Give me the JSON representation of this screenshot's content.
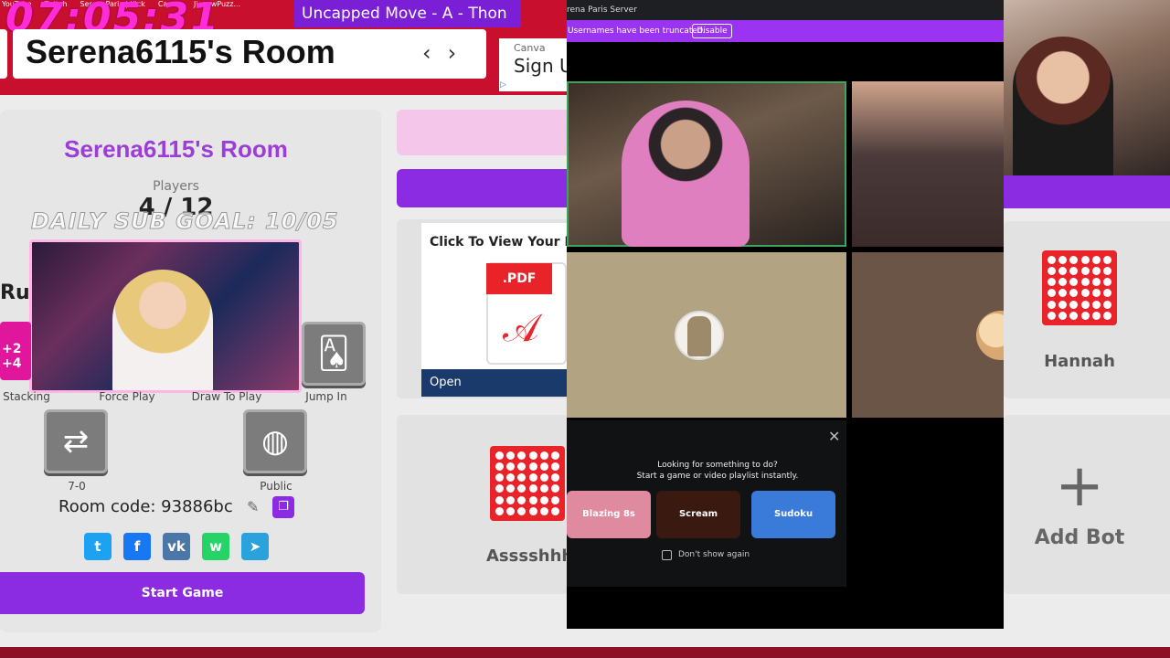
{
  "browser": {
    "bookmarks": [
      "YouTube",
      "Twitch",
      "SerenaParis | Kick",
      "Canva",
      "JigsawPuzz..."
    ],
    "timer": "07:05:31",
    "marquee": "Uncapped Move - A - Thon"
  },
  "header": {
    "room_title": "Serena6115's Room",
    "prev_arrow": "‹",
    "next_arrow": "›"
  },
  "ad_top": {
    "brand": "Canva",
    "cta": "Sign U",
    "mark": "▷"
  },
  "room": {
    "heading": "Serena6115's Room",
    "players_label": "Players",
    "players_count": "4 / 12",
    "sub_goal": "DAILY SUB GOAL: 10/05",
    "rules_label": "Rule",
    "stacking_badge": "+2 +4",
    "rules": [
      {
        "label": "Stacking"
      },
      {
        "label": "Force Play"
      },
      {
        "label": "Draw To Play"
      },
      {
        "label": "Jump In"
      }
    ],
    "settings": [
      {
        "label": "7-0"
      },
      {
        "label": "Public"
      }
    ],
    "room_code": "Room code: 93886bc",
    "start_button": "Start Game"
  },
  "share": [
    {
      "name": "twitter",
      "glyph": "t",
      "color": "#1da1f2"
    },
    {
      "name": "facebook",
      "glyph": "f",
      "color": "#1877f2"
    },
    {
      "name": "vk",
      "glyph": "vk",
      "color": "#4a76a8"
    },
    {
      "name": "whatsapp",
      "glyph": "w",
      "color": "#25d366"
    },
    {
      "name": "telegram",
      "glyph": "➤",
      "color": "#2aa3dc"
    }
  ],
  "pdf_ad": {
    "title": "Click To View Your P",
    "badge": ".PDF",
    "open": "Open"
  },
  "players": [
    {
      "name": "Asssshhh"
    },
    {
      "name": "Hannah"
    }
  ],
  "add_bot": {
    "plus": "+",
    "label": "Add Bot"
  },
  "discord": {
    "server_name": "rena Paris Server",
    "notice": "Usernames have been truncated.",
    "disable": "Disable",
    "popup_title_1": "Looking for something to do?",
    "popup_title_2": "Start a game or video playlist instantly.",
    "games": [
      {
        "name": "Blazing 8s",
        "color": "#e08aa0"
      },
      {
        "name": "Scream",
        "color": "#3a1a10"
      },
      {
        "name": "Sudoku Together",
        "color": "#3a7ad8"
      }
    ],
    "dont_show": "Don't show again"
  }
}
